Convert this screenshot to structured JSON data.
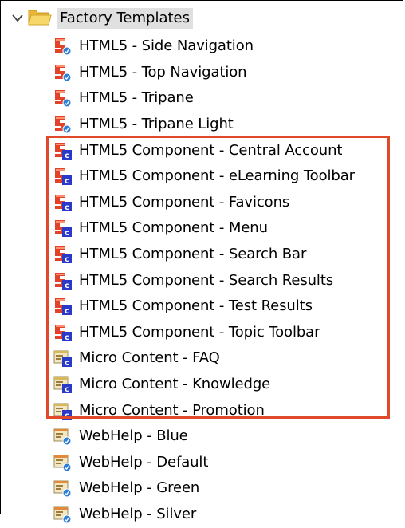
{
  "tree": {
    "root": {
      "label": "Factory Templates",
      "icon": "folder-open-icon",
      "expanded": true
    },
    "items": [
      {
        "label": "HTML5 - Side Navigation",
        "icon": "html5-skin-icon"
      },
      {
        "label": "HTML5 - Top Navigation",
        "icon": "html5-skin-icon"
      },
      {
        "label": "HTML5 - Tripane",
        "icon": "html5-skin-icon"
      },
      {
        "label": "HTML5 - Tripane Light",
        "icon": "html5-skin-icon"
      },
      {
        "label": "HTML5 Component - Central Account",
        "icon": "html5-component-icon"
      },
      {
        "label": "HTML5 Component - eLearning Toolbar",
        "icon": "html5-component-icon"
      },
      {
        "label": "HTML5 Component - Favicons",
        "icon": "html5-component-icon"
      },
      {
        "label": "HTML5 Component - Menu",
        "icon": "html5-component-icon"
      },
      {
        "label": "HTML5 Component - Search Bar",
        "icon": "html5-component-icon"
      },
      {
        "label": "HTML5 Component - Search Results",
        "icon": "html5-component-icon"
      },
      {
        "label": "HTML5 Component - Test Results",
        "icon": "html5-component-icon"
      },
      {
        "label": "HTML5 Component - Topic Toolbar",
        "icon": "html5-component-icon"
      },
      {
        "label": "Micro Content - FAQ",
        "icon": "micro-content-component-icon"
      },
      {
        "label": "Micro Content - Knowledge",
        "icon": "micro-content-component-icon"
      },
      {
        "label": "Micro Content - Promotion",
        "icon": "micro-content-component-icon"
      },
      {
        "label": "WebHelp - Blue",
        "icon": "webhelp-skin-icon"
      },
      {
        "label": "WebHelp - Default",
        "icon": "webhelp-skin-icon"
      },
      {
        "label": "WebHelp - Green",
        "icon": "webhelp-skin-icon"
      },
      {
        "label": "WebHelp - Silver",
        "icon": "webhelp-skin-icon"
      }
    ]
  },
  "colors": {
    "highlight_border": "#e04a2a",
    "html5_red": "#e2412a",
    "component_blue": "#2b39c8",
    "skin_blue": "#2f7fd8",
    "folder_yellow": "#f3c64a",
    "root_selection": "#e0e0e0"
  }
}
